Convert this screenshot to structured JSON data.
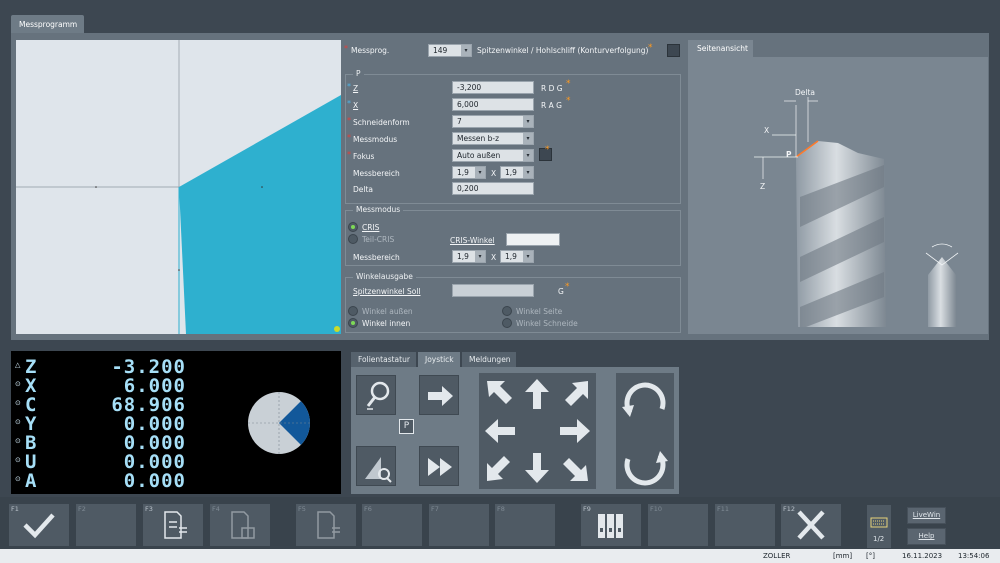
{
  "main_tab": "Messprogramm",
  "header": {
    "messprog_label": "Messprog.",
    "messprog_value": "149",
    "messprog_desc": "Spitzenwinkel / Hohlschliff (Konturverfolgung)"
  },
  "group_p": {
    "title": "P",
    "z_label": "Z",
    "z_value": "-3,200",
    "z_suffix": "R D G",
    "x_label": "X",
    "x_value": "6,000",
    "x_suffix": "R A G",
    "schneidenform_label": "Schneidenform",
    "schneidenform_value": "7",
    "messmodus_label": "Messmodus",
    "messmodus_value": "Messen b-z",
    "fokus_label": "Fokus",
    "fokus_value": "Auto außen",
    "messbereich_label": "Messbereich",
    "messbereich_a": "1,9",
    "messbereich_x": "X",
    "messbereich_b": "1,9",
    "delta_label": "Delta",
    "delta_value": "0,200"
  },
  "group_messmodus": {
    "title": "Messmodus",
    "cris_label": "CRIS",
    "cris_selected": true,
    "teilcris_label": "Teil-CRIS",
    "criswinkel_label": "CRIS-Winkel",
    "criswinkel_value": "",
    "messbereich_label": "Messbereich",
    "messbereich_a": "1,9",
    "messbereich_x": "X",
    "messbereich_b": "1,9"
  },
  "group_winkel": {
    "title": "Winkelausgabe",
    "spitzenwinkel_label": "Spitzenwinkel Soll",
    "spitzenwinkel_value": "",
    "spitzenwinkel_suffix": "G",
    "winkel_aussen": "Winkel außen",
    "winkel_innen": "Winkel innen",
    "winkel_innen_selected": true,
    "winkel_seite": "Winkel Seite",
    "winkel_schneide": "Winkel Schneide"
  },
  "side_view": {
    "tab": "Seitenansicht",
    "delta_label": "Delta",
    "x_label": "X",
    "p_label": "P",
    "z_label": "Z"
  },
  "dro": {
    "axes": [
      {
        "small": "△",
        "axis": "Z",
        "value": "-3.200"
      },
      {
        "small": "⊙",
        "axis": "X",
        "value": "6.000"
      },
      {
        "small": "⊙",
        "axis": "C",
        "value": "68.906"
      },
      {
        "small": "⊙",
        "axis": "Y",
        "value": "0.000"
      },
      {
        "small": "⊙",
        "axis": "B",
        "value": "0.000"
      },
      {
        "small": "⊙",
        "axis": "U",
        "value": "0.000"
      },
      {
        "small": "⊙",
        "axis": "A",
        "value": "0.000"
      }
    ],
    "c_angle_deg": 68.906
  },
  "joystick": {
    "tabs": [
      "Folientastatur",
      "Joystick",
      "Meldungen"
    ],
    "active_tab": "Joystick",
    "p_label": "P"
  },
  "fkeys": {
    "f1": "F1",
    "f2": "F2",
    "f3": "F3",
    "f4": "F4",
    "f5": "F5",
    "f6": "F6",
    "f7": "F7",
    "f8": "F8",
    "f9": "F9",
    "f10": "F10",
    "f11": "F11",
    "f12": "F12",
    "page": "1/2",
    "livewin": "LiveWin",
    "help": "Help"
  },
  "status": {
    "company": "ZOLLER",
    "unit_mm": "[mm]",
    "unit_deg": "[°]",
    "date": "16.11.2023",
    "time": "13:54:06"
  },
  "colors": {
    "accent_blue": "#2fb2d1",
    "background": "#3d4751",
    "panel": "#66727d",
    "dro_text": "#a6dff7",
    "required_star": "#e0403c",
    "optional_star": "#ff9a1e",
    "radio_on": "#7ed957"
  }
}
